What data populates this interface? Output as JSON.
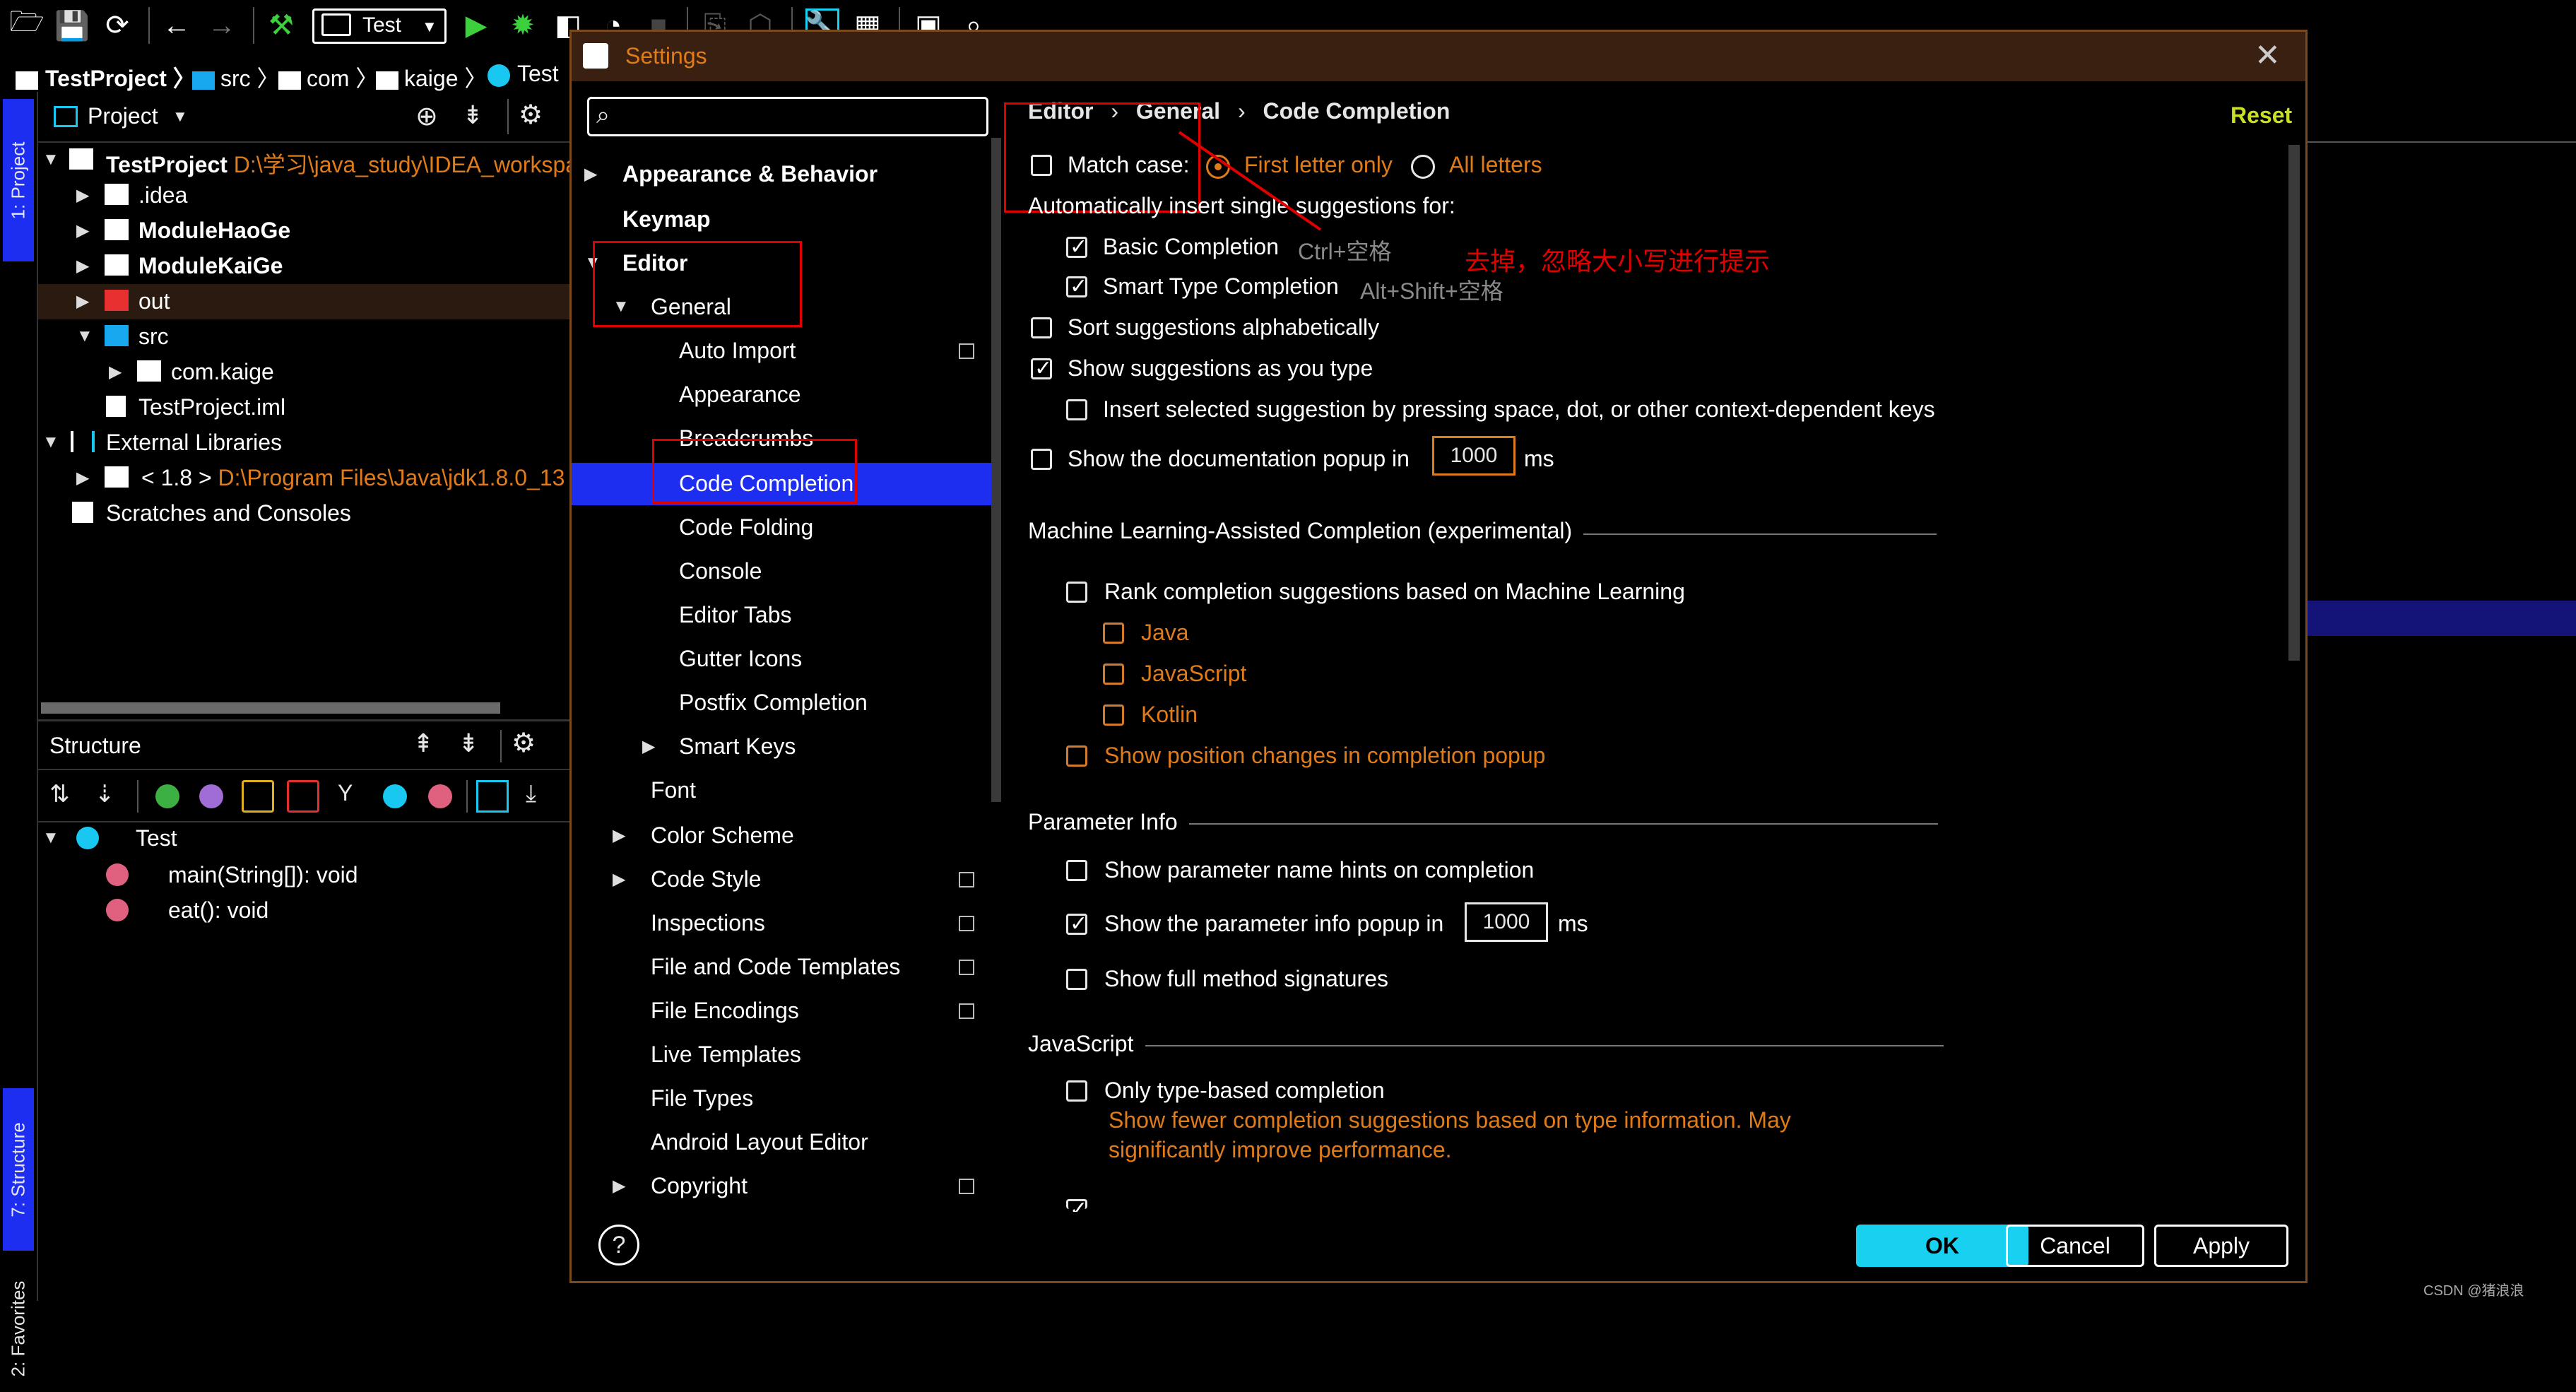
{
  "toolbar": {
    "run_config": "Test"
  },
  "breadcrumb": {
    "items": [
      "TestProject",
      "src",
      "com",
      "kaige",
      "Test"
    ]
  },
  "left_stripe": {
    "project_tab": "1: Project",
    "structure_tab": "7: Structure",
    "favorites_tab": "2: Favorites"
  },
  "project_panel": {
    "title": "Project",
    "tree": [
      {
        "label": "TestProject",
        "path": "D:\\学习\\java_study\\IDEA_workspa"
      },
      {
        "label": ".idea"
      },
      {
        "label": "ModuleHaoGe"
      },
      {
        "label": "ModuleKaiGe"
      },
      {
        "label": "out"
      },
      {
        "label": "src"
      },
      {
        "label": "com.kaige"
      },
      {
        "label": "TestProject.iml"
      },
      {
        "label": "External Libraries"
      },
      {
        "label": "< 1.8 >",
        "path": "D:\\Program Files\\Java\\jdk1.8.0_13"
      },
      {
        "label": "Scratches and Consoles"
      }
    ]
  },
  "structure_panel": {
    "title": "Structure",
    "items": [
      {
        "label": "Test"
      },
      {
        "label": "main(String[]): void"
      },
      {
        "label": "eat(): void"
      }
    ]
  },
  "dialog": {
    "title": "Settings",
    "search_placeholder": "",
    "nav": [
      {
        "label": "Appearance & Behavior"
      },
      {
        "label": "Keymap"
      },
      {
        "label": "Editor"
      },
      {
        "label": "General"
      },
      {
        "label": "Auto Import"
      },
      {
        "label": "Appearance"
      },
      {
        "label": "Breadcrumbs"
      },
      {
        "label": "Code Completion"
      },
      {
        "label": "Code Folding"
      },
      {
        "label": "Console"
      },
      {
        "label": "Editor Tabs"
      },
      {
        "label": "Gutter Icons"
      },
      {
        "label": "Postfix Completion"
      },
      {
        "label": "Smart Keys"
      },
      {
        "label": "Font"
      },
      {
        "label": "Color Scheme"
      },
      {
        "label": "Code Style"
      },
      {
        "label": "Inspections"
      },
      {
        "label": "File and Code Templates"
      },
      {
        "label": "File Encodings"
      },
      {
        "label": "Live Templates"
      },
      {
        "label": "File Types"
      },
      {
        "label": "Android Layout Editor"
      },
      {
        "label": "Copyright"
      }
    ],
    "content_breadcrumb": [
      "Editor",
      "General",
      "Code Completion"
    ],
    "reset": "Reset",
    "match_case": "Match case:",
    "first_letter_only": "First letter only",
    "all_letters": "All letters",
    "auto_insert_title": "Automatically insert single suggestions for:",
    "basic_completion": "Basic Completion",
    "basic_shortcut": "Ctrl+空格",
    "smart_completion": "Smart Type Completion",
    "smart_shortcut": "Alt+Shift+空格",
    "annotation": "去掉，忽略大小写进行提示",
    "sort_alpha": "Sort suggestions alphabetically",
    "show_as_type": "Show suggestions as you type",
    "insert_selected": "Insert selected suggestion by pressing space, dot, or other context-dependent keys",
    "show_doc_popup": "Show the documentation popup in",
    "doc_popup_ms": "1000",
    "ms": "ms",
    "ml_section": "Machine Learning-Assisted Completion (experimental)",
    "ml_rank": "Rank completion suggestions based on Machine Learning",
    "ml_java": "Java",
    "ml_js": "JavaScript",
    "ml_kotlin": "Kotlin",
    "ml_position": "Show position changes in completion popup",
    "param_section": "Parameter Info",
    "param_hints": "Show parameter name hints on completion",
    "param_popup": "Show the parameter info popup in",
    "param_popup_ms": "1000",
    "param_full": "Show full method signatures",
    "js_section": "JavaScript",
    "js_type_based": "Only type-based completion",
    "js_type_desc1": "Show fewer completion suggestions based on type information. May",
    "js_type_desc2": "significantly improve performance.",
    "ok": "OK",
    "cancel": "Cancel",
    "apply": "Apply",
    "help": "?"
  },
  "watermark": "CSDN @猪浪浪",
  "colors": {
    "accent_orange": "#e07b1a",
    "selection_blue": "#1e2ef0",
    "ok_cyan": "#18d0f0",
    "annotation_red": "#e00000",
    "title_bar": "#3a2010"
  }
}
